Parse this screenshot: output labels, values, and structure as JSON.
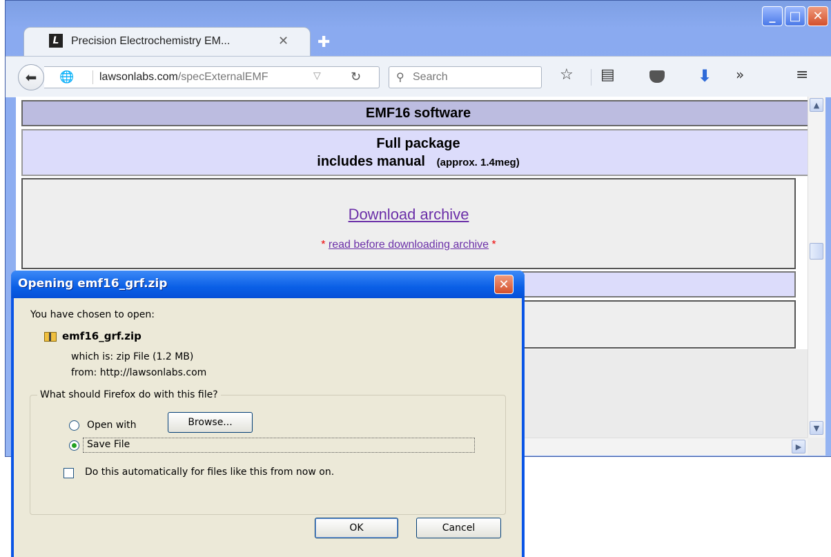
{
  "browser": {
    "tab_title": "Precision Electrochemistry EM...",
    "tab_close": "✕",
    "new_tab": "✚",
    "url_host": "lawsonlabs.com",
    "url_path": "/specExternalEMF",
    "search_placeholder": "Search",
    "window_buttons": [
      "minimize",
      "maximize",
      "close"
    ]
  },
  "page": {
    "row1": "EMF16 software",
    "row2_line1": "Full package",
    "row2_line2": "includes manual",
    "row2_small": "(approx. 1.4meg)",
    "download_link": "Download archive",
    "read_before_link": "read before downloading archive",
    "star": "*"
  },
  "dialog": {
    "title": "Opening emf16_grf.zip",
    "chosen_text": "You have chosen to open:",
    "filename": "emf16_grf.zip",
    "which_is": "which is:  zip File (1.2 MB)",
    "from": "from:  http://lawsonlabs.com",
    "question": "What should Firefox do with this file?",
    "open_with_label": "Open with",
    "browse_label": "Browse...",
    "save_file_label": "Save File",
    "auto_label": "Do this automatically for files like this from now on.",
    "ok_label": "OK",
    "cancel_label": "Cancel",
    "selected_option": "save_file",
    "auto_checked": false
  },
  "colors": {
    "xp_title_blue": "#0a5fe6",
    "dialog_bg": "#ece9d8",
    "link_purple": "#6b2fa8",
    "header_row": "#bcbce0",
    "light_row": "#dcdcfb"
  }
}
